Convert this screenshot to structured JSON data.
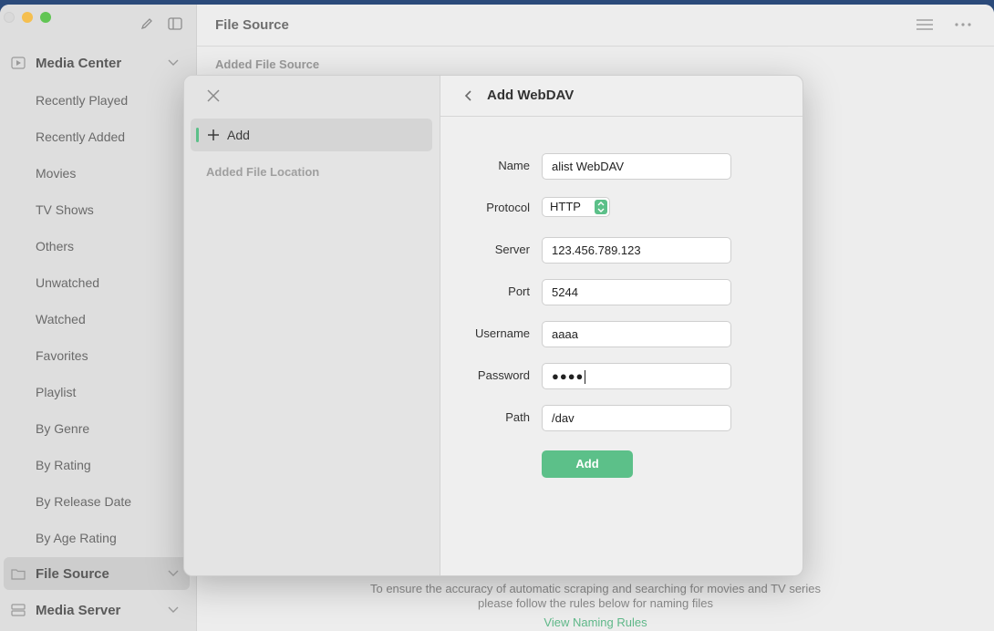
{
  "sidebar": {
    "sections": [
      {
        "label": "Media Center"
      },
      {
        "label": "File Source"
      },
      {
        "label": "Media Server"
      }
    ],
    "items": [
      {
        "label": "Recently Played"
      },
      {
        "label": "Recently Added"
      },
      {
        "label": "Movies"
      },
      {
        "label": "TV Shows"
      },
      {
        "label": "Others"
      },
      {
        "label": "Unwatched"
      },
      {
        "label": "Watched"
      },
      {
        "label": "Favorites"
      },
      {
        "label": "Playlist"
      },
      {
        "label": "By Genre"
      },
      {
        "label": "By Rating"
      },
      {
        "label": "By Release Date"
      },
      {
        "label": "By Age Rating"
      }
    ]
  },
  "main": {
    "title": "File Source",
    "section_label": "Added File Source",
    "footer_line1": "To ensure the accuracy of automatic scraping and searching for movies and TV series",
    "footer_line2": "please follow the rules below for naming files",
    "footer_link": "View Naming Rules"
  },
  "dialog": {
    "add_label": "Add",
    "added_location_label": "Added File Location",
    "title": "Add WebDAV",
    "fields": {
      "name": {
        "label": "Name",
        "value": "alist WebDAV"
      },
      "protocol": {
        "label": "Protocol",
        "value": "HTTP"
      },
      "server": {
        "label": "Server",
        "value": "123.456.789.123"
      },
      "port": {
        "label": "Port",
        "value": "5244"
      },
      "username": {
        "label": "Username",
        "value": "aaaa"
      },
      "password": {
        "label": "Password",
        "value": "●●●●"
      },
      "path": {
        "label": "Path",
        "value": "/dav"
      }
    },
    "submit_label": "Add"
  },
  "colors": {
    "accent": "#5cc089",
    "link": "#5fb889"
  }
}
